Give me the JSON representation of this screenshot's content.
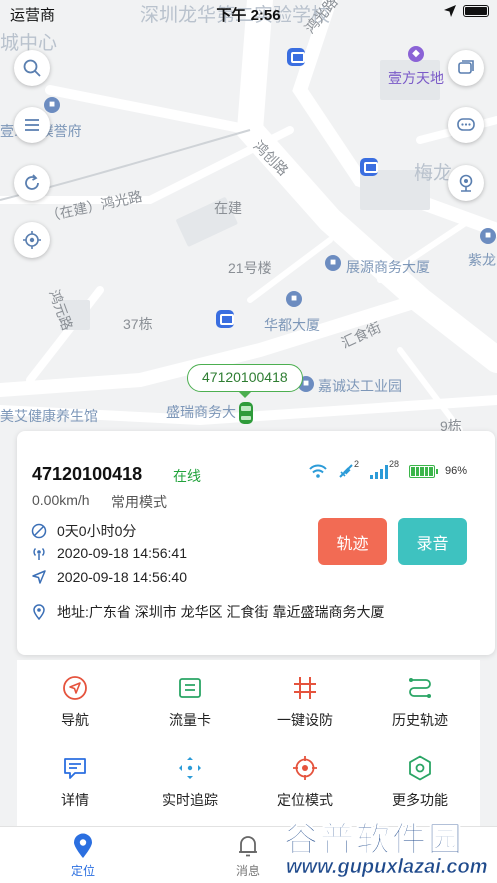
{
  "status_bar": {
    "carrier": "运营商",
    "time": "下午 2:56"
  },
  "map": {
    "labels": {
      "school": "深圳龙华第二实验学校",
      "road_top": "鸿光路",
      "city_center": "城中心",
      "shopping": "壹方天地",
      "yuepu": "壹...心璞誉府",
      "meilong": "梅龙",
      "hongchuang": "鸿创路",
      "zaijian_hongguang": "（在建）鸿光路",
      "zaijian": "在建",
      "bldg21": "21号楼",
      "zhanyuan": "展源商务大厦",
      "zilong": "紫龙",
      "hongyuan": "鸿元路",
      "bldg37": "37栋",
      "huadu": "华都大厦",
      "huishi": "汇食街",
      "jiacheng": "嘉诚达工业园",
      "meiai": "美艾健康养生馆",
      "shengrui": "盛瑞商务大",
      "bldg9": "9栋"
    },
    "device_tag": "47120100418"
  },
  "card": {
    "device_id": "47120100418",
    "online_status": "在线",
    "gps_sats": "2",
    "signal": "28",
    "battery": "96%",
    "speed": "0.00km/h",
    "mode": "常用模式",
    "still_duration": "0天0小时0分",
    "signal_time": "2020-09-18 14:56:41",
    "locate_time": "2020-09-18 14:56:40",
    "address": "地址:广东省 深圳市 龙华区 汇食街 靠近盛瑞商务大厦",
    "track_label": "轨迹",
    "record_label": "录音"
  },
  "actions": [
    {
      "label": "导航",
      "icon": "navigation-icon"
    },
    {
      "label": "流量卡",
      "icon": "sim-card-icon"
    },
    {
      "label": "一键设防",
      "icon": "fence-icon"
    },
    {
      "label": "历史轨迹",
      "icon": "history-track-icon"
    },
    {
      "label": "详情",
      "icon": "detail-icon"
    },
    {
      "label": "实时追踪",
      "icon": "realtime-tracking-icon"
    },
    {
      "label": "定位模式",
      "icon": "locate-mode-icon"
    },
    {
      "label": "更多功能",
      "icon": "more-functions-icon"
    }
  ],
  "tabs": [
    {
      "label": "定位"
    },
    {
      "label": "消息"
    }
  ],
  "watermark": {
    "title": "谷普软件园",
    "url": "www.gupuxlazai.com"
  },
  "colors": {
    "accent": "#2b6fe0",
    "online": "#22a33c",
    "track_button": "#f26b54",
    "record_button": "#3ec2c0"
  }
}
